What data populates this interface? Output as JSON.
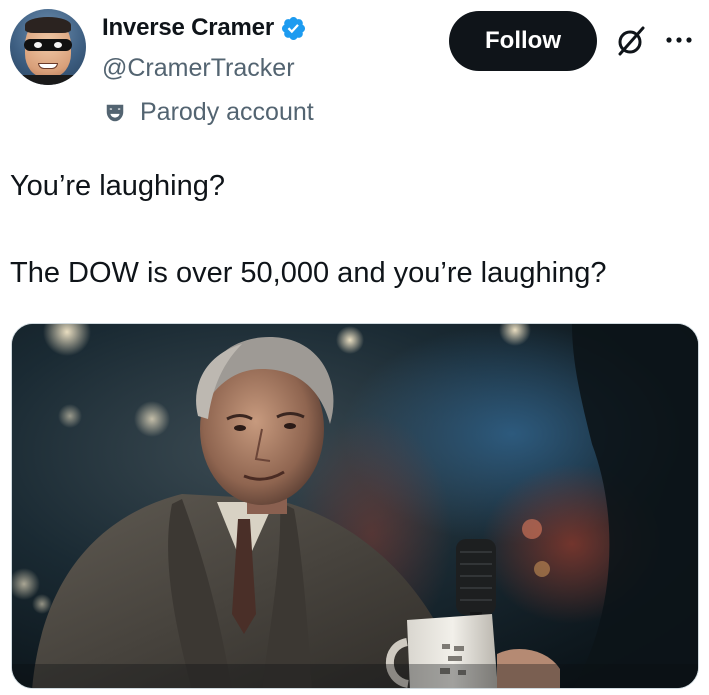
{
  "author": {
    "display_name": "Inverse Cramer",
    "handle": "@CramerTracker",
    "verified": true,
    "label": "Parody account"
  },
  "actions": {
    "follow_label": "Follow"
  },
  "tweet": {
    "paragraphs": [
      "You’re laughing?",
      "The DOW is over 50,000 and you’re laughing?"
    ]
  },
  "colors": {
    "text_primary": "#0f1419",
    "text_secondary": "#536471",
    "verified_blue": "#1d9bf0",
    "follow_bg": "#0f1419",
    "border": "#cfd9de"
  },
  "icons": {
    "verified": "verified-badge-icon",
    "parody": "theater-mask-icon",
    "grok": "grok-slash-circle-icon",
    "more": "more-dots-icon"
  }
}
